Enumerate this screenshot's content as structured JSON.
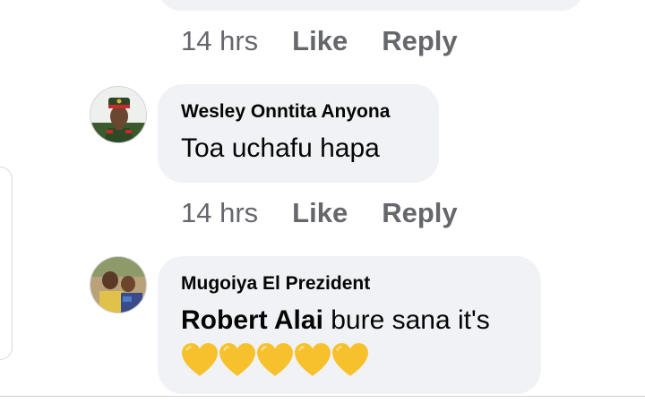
{
  "prev_comment": {
    "time": "14 hrs",
    "like_label": "Like",
    "reply_label": "Reply"
  },
  "comments": [
    {
      "author": "Wesley Onntita Anyona",
      "text": "Toa uchafu hapa",
      "time": "14 hrs",
      "like_label": "Like",
      "reply_label": "Reply"
    },
    {
      "author": "Mugoiya El Prezident",
      "mention": "Robert Alai",
      "text": " bure sana it's",
      "emoji_count": 5,
      "emoji": "yellow-heart"
    }
  ],
  "colors": {
    "bubble": "#f0f2f5",
    "meta_text": "#65676b",
    "heart": "#f7c12d"
  }
}
